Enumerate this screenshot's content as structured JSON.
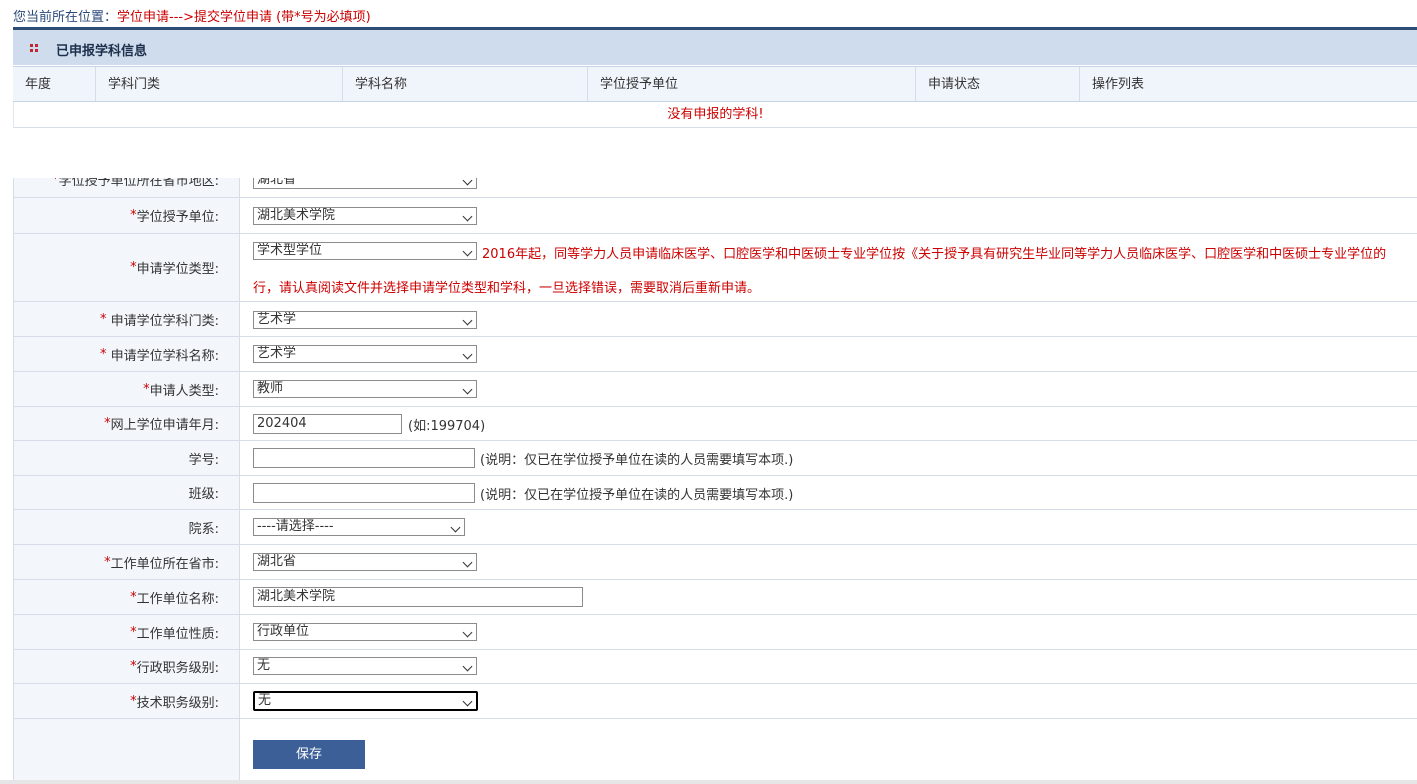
{
  "breadcrumb": {
    "prefix": "您当前所在位置：",
    "path": "学位申请--->提交学位申请 (带*号为必填项)"
  },
  "panel": {
    "title": "已申报学科信息",
    "columns": [
      "年度",
      "学科门类",
      "学科名称",
      "学位授予单位",
      "申请状态",
      "操作列表"
    ],
    "empty_message": "没有申报的学科!"
  },
  "form": {
    "region": {
      "label": "学位授予单位所在省市地区:",
      "value": "湖北省"
    },
    "grant_unit": {
      "label": "学位授予单位:",
      "value": "湖北美术学院"
    },
    "degree_type": {
      "label": "申请学位类型:",
      "value": "学术型学位",
      "notice_line1": "2016年起，同等学力人员申请临床医学、口腔医学和中医硕士专业学位按《关于授予具有研究生毕业同等学力人员临床医学、口腔医学和中医硕士专业学位的",
      "notice_line2": "行，请认真阅读文件并选择申请学位类型和学科，一旦选择错误，需要取消后重新申请。"
    },
    "discipline_category": {
      "label": "申请学位学科门类:",
      "value": "艺术学"
    },
    "discipline_name": {
      "label": "申请学位学科名称:",
      "value": "艺术学"
    },
    "applicant_type": {
      "label": "申请人类型:",
      "value": "教师"
    },
    "apply_month": {
      "label": "网上学位申请年月:",
      "value": "202404",
      "hint": "(如:199704)"
    },
    "student_id": {
      "label": "学号:",
      "value": "",
      "hint": "(说明：仅已在学位授予单位在读的人员需要填写本项.)"
    },
    "class_name": {
      "label": "班级:",
      "value": "",
      "hint": "(说明：仅已在学位授予单位在读的人员需要填写本项.)"
    },
    "department": {
      "label": "院系:",
      "value": "----请选择----"
    },
    "work_province": {
      "label": "工作单位所在省市:",
      "value": "湖北省"
    },
    "work_unit_name": {
      "label": "工作单位名称:",
      "value": "湖北美术学院"
    },
    "work_unit_nature": {
      "label": "工作单位性质:",
      "value": "行政单位"
    },
    "admin_level": {
      "label": "行政职务级别:",
      "value": "无"
    },
    "tech_level": {
      "label": "技术职务级别:",
      "value": "无"
    },
    "save_label": "保存",
    "required_mark": "*"
  },
  "colors": {
    "accent": "#2e4d74",
    "required": "#cc0000",
    "button": "#3b5f96"
  }
}
